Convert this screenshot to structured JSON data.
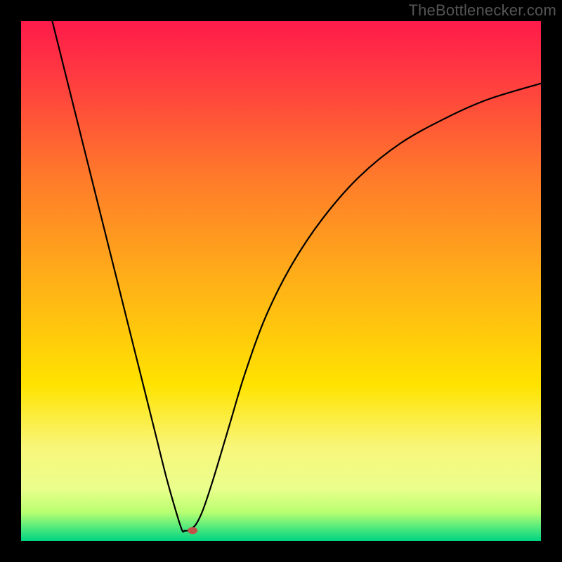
{
  "watermark": "TheBottlenecker.com",
  "chart_data": {
    "type": "line",
    "title": "",
    "xlabel": "",
    "ylabel": "",
    "xlim": [
      0,
      100
    ],
    "ylim": [
      0,
      100
    ],
    "background_gradient": {
      "stops": [
        {
          "offset": 0.0,
          "color": "#ff1a4a"
        },
        {
          "offset": 0.12,
          "color": "#ff3f3f"
        },
        {
          "offset": 0.3,
          "color": "#ff7a2a"
        },
        {
          "offset": 0.5,
          "color": "#ffb018"
        },
        {
          "offset": 0.7,
          "color": "#ffe300"
        },
        {
          "offset": 0.82,
          "color": "#f8f67a"
        },
        {
          "offset": 0.9,
          "color": "#eaff8c"
        },
        {
          "offset": 0.945,
          "color": "#b8ff70"
        },
        {
          "offset": 0.975,
          "color": "#4fe97d"
        },
        {
          "offset": 1.0,
          "color": "#00d482"
        }
      ]
    },
    "curve": {
      "x": [
        6,
        8,
        10,
        12,
        14,
        16,
        18,
        20,
        22,
        24,
        26,
        28,
        30,
        31,
        31.5,
        32,
        33.5,
        35,
        37,
        40,
        43,
        47,
        52,
        58,
        65,
        73,
        82,
        90,
        100
      ],
      "y": [
        100,
        92,
        84,
        76,
        68,
        60,
        52,
        44,
        36,
        28,
        20,
        12,
        5,
        2,
        2,
        2,
        3,
        6,
        12,
        22,
        32,
        43,
        53,
        62,
        70,
        76.5,
        81.5,
        85,
        88
      ]
    },
    "marker": {
      "x": 33,
      "y": 2,
      "color": "#c0544a"
    },
    "legend": null,
    "grid": false
  }
}
